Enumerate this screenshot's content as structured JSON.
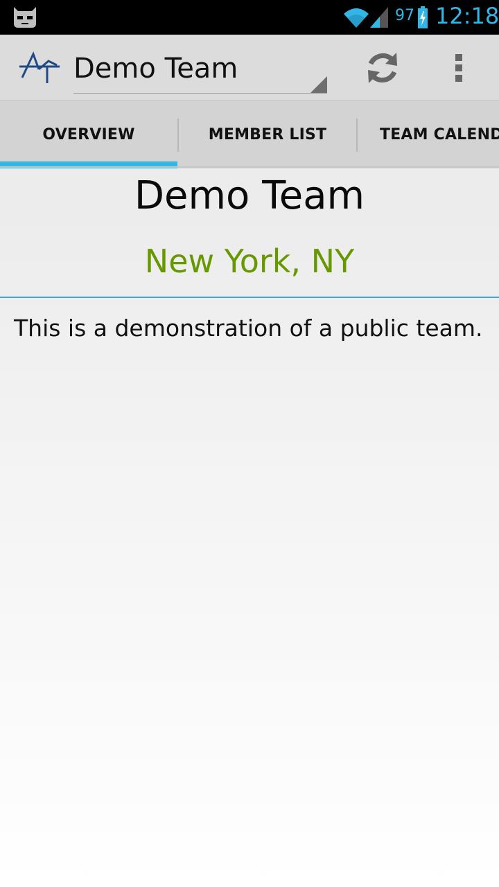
{
  "status_bar": {
    "battery_percent": "97",
    "time": "12:18",
    "accent_color": "#33b5e5",
    "icons": [
      "cyanogenmod-mascot-icon",
      "wifi-icon",
      "signal-icon",
      "battery-charging-icon"
    ]
  },
  "action_bar": {
    "logo_icon": "app-logo-icon",
    "team_selector": "Demo Team",
    "refresh_icon": "refresh-icon",
    "overflow_icon": "overflow-menu-icon"
  },
  "tabs": [
    {
      "label": "OVERVIEW",
      "selected": true
    },
    {
      "label": "MEMBER LIST",
      "selected": false
    },
    {
      "label": "TEAM CALENDAR",
      "selected": false
    }
  ],
  "overview": {
    "title": "Demo Team",
    "location": "New York, NY",
    "location_color": "#669900",
    "description": "This is a demonstration of a public team."
  }
}
